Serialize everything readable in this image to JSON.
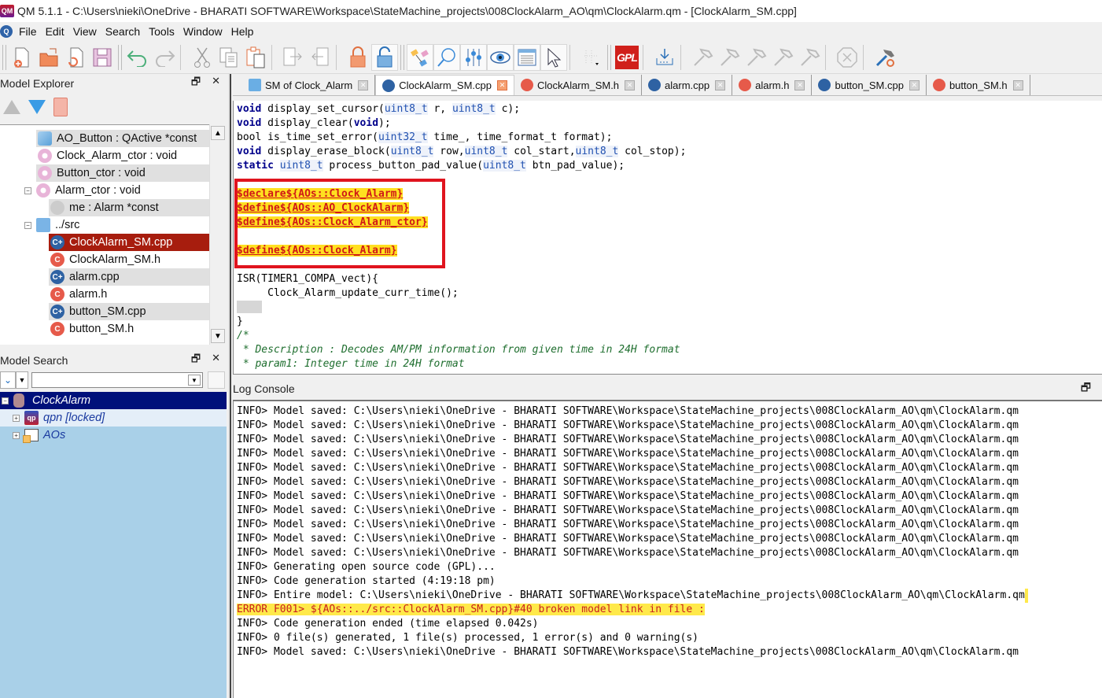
{
  "window": {
    "title": "QM 5.1.1 - C:\\Users\\nieki\\OneDrive - BHARATI SOFTWARE\\Workspace\\StateMachine_projects\\008ClockAlarm_AO\\qm\\ClockAlarm.qm - [ClockAlarm_SM.cpp]",
    "app_icon": "qm-app-icon"
  },
  "menu": [
    "File",
    "Edit",
    "View",
    "Search",
    "Tools",
    "Window",
    "Help"
  ],
  "toolbar": {
    "groups": [
      [
        "new-model-icon",
        "open-model-icon",
        "reload-model-icon",
        "save-model-icon"
      ],
      [
        "undo-icon",
        "redo-icon"
      ],
      [
        "cut-icon",
        "copy-icon",
        "paste-icon"
      ],
      [
        "export-link-icon",
        "import-link-icon"
      ],
      [
        "lock-icon",
        "unlock-icon"
      ],
      [
        "model-explorer-icon",
        "search-icon",
        "properties-icon",
        "view-icon",
        "log-icon",
        "select-icon",
        "grid-icon"
      ],
      [
        "gpl-license-icon",
        "generate-code-icon",
        "build-icon",
        "build-icon-2",
        "build-icon-3",
        "build-icon-4",
        "build-icon-5",
        "stop-icon",
        "manage-tools-icon"
      ]
    ],
    "gpl_label": "GPL"
  },
  "model_explorer": {
    "title": "Model Explorer",
    "items": [
      {
        "label": "AO_Button : QActive *const",
        "icon": "ao-pointer-icon",
        "indent": 2,
        "alt": true
      },
      {
        "label": "Clock_Alarm_ctor : void",
        "icon": "operation-icon",
        "indent": 2,
        "alt": false
      },
      {
        "label": "Button_ctor : void",
        "icon": "operation-icon",
        "indent": 2,
        "alt": true
      },
      {
        "label": "Alarm_ctor : void",
        "icon": "operation-icon",
        "indent": 2,
        "alt": false,
        "expanded": true
      },
      {
        "label": "me : Alarm *const",
        "icon": "attribute-icon",
        "indent": 3,
        "alt": true
      },
      {
        "label": "../src",
        "icon": "folder-icon",
        "indent": 2,
        "alt": false,
        "expanded": true
      },
      {
        "label": "ClockAlarm_SM.cpp",
        "icon": "cpp-file-icon",
        "indent": 3,
        "selected": true
      },
      {
        "label": "ClockAlarm_SM.h",
        "icon": "h-file-icon",
        "indent": 3,
        "alt": false
      },
      {
        "label": "alarm.cpp",
        "icon": "cpp-file-icon",
        "indent": 3,
        "alt": true
      },
      {
        "label": "alarm.h",
        "icon": "h-file-icon",
        "indent": 3,
        "alt": false
      },
      {
        "label": "button_SM.cpp",
        "icon": "cpp-file-icon",
        "indent": 3,
        "alt": true
      },
      {
        "label": "button_SM.h",
        "icon": "h-file-icon",
        "indent": 3,
        "alt": false
      }
    ]
  },
  "model_search": {
    "title": "Model Search",
    "search_value": "",
    "items": [
      {
        "label": "ClockAlarm",
        "type": "root"
      },
      {
        "label": "qpn [locked]",
        "type": "locked"
      },
      {
        "label": "AOs",
        "type": "package"
      }
    ]
  },
  "tabs": [
    {
      "label": "SM of Clock_Alarm",
      "icon": "state-machine-icon",
      "active": false
    },
    {
      "label": "ClockAlarm_SM.cpp",
      "icon": "cpp-file-icon",
      "active": true
    },
    {
      "label": "ClockAlarm_SM.h",
      "icon": "h-file-icon",
      "active": false
    },
    {
      "label": "alarm.cpp",
      "icon": "cpp-file-icon",
      "active": false
    },
    {
      "label": "alarm.h",
      "icon": "h-file-icon",
      "active": false
    },
    {
      "label": "button_SM.cpp",
      "icon": "cpp-file-icon",
      "active": false
    },
    {
      "label": "button_SM.h",
      "icon": "h-file-icon",
      "active": false
    }
  ],
  "editor": {
    "lines": [
      [
        {
          "t": "void",
          "c": "kw"
        },
        {
          "t": " display_set_cursor("
        },
        {
          "t": "uint8_t",
          "c": "ty"
        },
        {
          "t": " r, "
        },
        {
          "t": "uint8_t",
          "c": "ty"
        },
        {
          "t": " c);"
        }
      ],
      [
        {
          "t": "void",
          "c": "kw"
        },
        {
          "t": " display_clear("
        },
        {
          "t": "void",
          "c": "kw"
        },
        {
          "t": ");"
        }
      ],
      [
        {
          "t": "bool is_time_set_error("
        },
        {
          "t": "uint32_t",
          "c": "ty"
        },
        {
          "t": " time_, time_format_t format);"
        }
      ],
      [
        {
          "t": "void",
          "c": "kw"
        },
        {
          "t": " display_erase_block("
        },
        {
          "t": "uint8_t",
          "c": "ty"
        },
        {
          "t": " row,"
        },
        {
          "t": "uint8_t",
          "c": "ty"
        },
        {
          "t": " col_start,"
        },
        {
          "t": "uint8_t",
          "c": "ty"
        },
        {
          "t": " col_stop);"
        }
      ],
      [
        {
          "t": "static",
          "c": "kw"
        },
        {
          "t": " "
        },
        {
          "t": "uint8_t",
          "c": "ty"
        },
        {
          "t": " process_button_pad_value("
        },
        {
          "t": "uint8_t",
          "c": "ty"
        },
        {
          "t": " btn_pad_value);"
        }
      ],
      [],
      [
        {
          "t": "$declare${AOs::Clock_Alarm}",
          "c": "mdl"
        }
      ],
      [
        {
          "t": "$define${AOs::AO_ClockAlarm}",
          "c": "mdl"
        }
      ],
      [
        {
          "t": "$define${AOs::Clock_Alarm_ctor}",
          "c": "mdl"
        }
      ],
      [],
      [
        {
          "t": "$define${AOs::Clock_Alarm}",
          "c": "mdl"
        }
      ],
      [],
      [
        {
          "t": "ISR(TIMER1_COMPA_vect){"
        }
      ],
      [
        {
          "t": "     Clock_Alarm_update_curr_time();"
        }
      ],
      [
        {
          "t": "",
          "c": "blk"
        }
      ],
      [
        {
          "t": "}"
        }
      ],
      [
        {
          "t": "/*",
          "c": "cm"
        }
      ],
      [
        {
          "t": " * Description : Decodes AM/PM information from given time in 24H format",
          "c": "cm"
        }
      ],
      [
        {
          "t": " * param1: Integer time in 24H format",
          "c": "cm"
        }
      ]
    ]
  },
  "log_console": {
    "title": "Log Console",
    "lines": [
      {
        "text": "INFO> Model saved: C:\\Users\\nieki\\OneDrive - BHARATI SOFTWARE\\Workspace\\StateMachine_projects\\008ClockAlarm_AO\\qm\\ClockAlarm.qm"
      },
      {
        "text": "INFO> Model saved: C:\\Users\\nieki\\OneDrive - BHARATI SOFTWARE\\Workspace\\StateMachine_projects\\008ClockAlarm_AO\\qm\\ClockAlarm.qm"
      },
      {
        "text": "INFO> Model saved: C:\\Users\\nieki\\OneDrive - BHARATI SOFTWARE\\Workspace\\StateMachine_projects\\008ClockAlarm_AO\\qm\\ClockAlarm.qm"
      },
      {
        "text": "INFO> Model saved: C:\\Users\\nieki\\OneDrive - BHARATI SOFTWARE\\Workspace\\StateMachine_projects\\008ClockAlarm_AO\\qm\\ClockAlarm.qm"
      },
      {
        "text": "INFO> Model saved: C:\\Users\\nieki\\OneDrive - BHARATI SOFTWARE\\Workspace\\StateMachine_projects\\008ClockAlarm_AO\\qm\\ClockAlarm.qm"
      },
      {
        "text": "INFO> Model saved: C:\\Users\\nieki\\OneDrive - BHARATI SOFTWARE\\Workspace\\StateMachine_projects\\008ClockAlarm_AO\\qm\\ClockAlarm.qm"
      },
      {
        "text": "INFO> Model saved: C:\\Users\\nieki\\OneDrive - BHARATI SOFTWARE\\Workspace\\StateMachine_projects\\008ClockAlarm_AO\\qm\\ClockAlarm.qm"
      },
      {
        "text": "INFO> Model saved: C:\\Users\\nieki\\OneDrive - BHARATI SOFTWARE\\Workspace\\StateMachine_projects\\008ClockAlarm_AO\\qm\\ClockAlarm.qm"
      },
      {
        "text": "INFO> Model saved: C:\\Users\\nieki\\OneDrive - BHARATI SOFTWARE\\Workspace\\StateMachine_projects\\008ClockAlarm_AO\\qm\\ClockAlarm.qm"
      },
      {
        "text": "INFO> Model saved: C:\\Users\\nieki\\OneDrive - BHARATI SOFTWARE\\Workspace\\StateMachine_projects\\008ClockAlarm_AO\\qm\\ClockAlarm.qm"
      },
      {
        "text": "INFO> Model saved: C:\\Users\\nieki\\OneDrive - BHARATI SOFTWARE\\Workspace\\StateMachine_projects\\008ClockAlarm_AO\\qm\\ClockAlarm.qm"
      },
      {
        "text": "INFO> Generating open source code (GPL)..."
      },
      {
        "text": "INFO> Code generation started (4:19:18 pm)"
      },
      {
        "text": "INFO> Entire model: C:\\Users\\nieki\\OneDrive - BHARATI SOFTWARE\\Workspace\\StateMachine_projects\\008ClockAlarm_AO\\qm\\ClockAlarm.qm",
        "tail_highlight": true
      },
      {
        "text": "ERROR F001> ${AOs::../src::ClockAlarm_SM.cpp}#40 broken model link in file :",
        "level": "error"
      },
      {
        "text": "INFO> Code generation ended (time elapsed 0.042s)"
      },
      {
        "text": "INFO> 0 file(s) generated, 1 file(s) processed, 1 error(s) and 0 warning(s)"
      },
      {
        "text": "INFO> Model saved: C:\\Users\\nieki\\OneDrive - BHARATI SOFTWARE\\Workspace\\StateMachine_projects\\008ClockAlarm_AO\\qm\\ClockAlarm.qm"
      }
    ]
  },
  "colors": {
    "selected_item": "#a71d0e",
    "model_search_bg": "#a9d0e8",
    "model_search_root": "#00107a",
    "error_highlight": "#ffe94a",
    "annotation_box": "#e0141e",
    "model_link_text": "#d01818"
  }
}
